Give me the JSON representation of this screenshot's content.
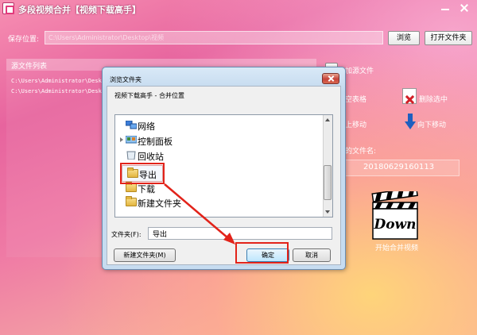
{
  "window": {
    "title": "多段视频合并【视频下载高手】"
  },
  "save": {
    "label": "保存位置:",
    "path": "C:\\Users\\Administrator\\Desktop\\视频",
    "browse_label": "浏览",
    "open_folder_label": "打开文件夹"
  },
  "source_list": {
    "header": "源文件列表",
    "items": [
      "C:\\Users\\Administrator\\Desktop",
      "C:\\Users\\Administrator\\Desktop"
    ]
  },
  "side": {
    "add_source_label": "加源文件",
    "clear_label": "空表格",
    "remove_selected_label": "删除选中",
    "move_up_label": "上移动",
    "move_down_label": "向下移动",
    "filename_label": "的文件名:",
    "filename_value": "20180629160113",
    "start_merge_label": "开始合并视频",
    "down_logo_text": "Down"
  },
  "dialog": {
    "title": "浏览文件夹",
    "description": "视频下载高手 - 合并位置",
    "tree_items": [
      {
        "label": "网络",
        "icon": "network-icon"
      },
      {
        "label": "控制面板",
        "icon": "control-panel-icon"
      },
      {
        "label": "回收站",
        "icon": "recycle-bin-icon"
      },
      {
        "label": "导出",
        "icon": "folder-icon"
      },
      {
        "label": "下载",
        "icon": "folder-icon"
      },
      {
        "label": "新建文件夹",
        "icon": "folder-icon"
      }
    ],
    "folder_label": "文件夹(F):",
    "folder_value": "导出",
    "new_folder_label": "新建文件夹(M)",
    "ok_label": "确定",
    "cancel_label": "取消"
  },
  "colors": {
    "annotation": "#e2231a",
    "accent_pink": "#e7649e"
  }
}
